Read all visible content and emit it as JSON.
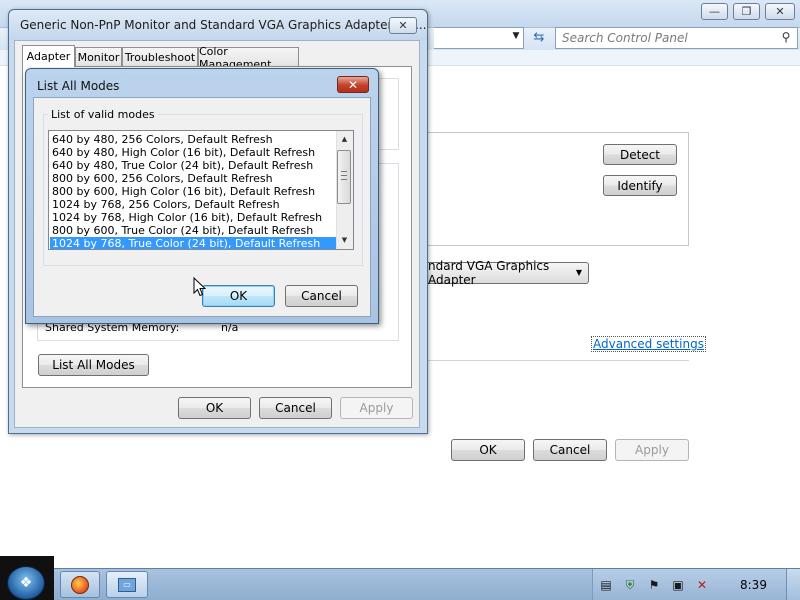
{
  "background_window": {
    "caption_buttons": [
      "—",
      "❐",
      "✕"
    ],
    "search_placeholder": "Search Control Panel",
    "detect_label": "Detect",
    "identify_label": "Identify",
    "adapter_select_value": "ndard VGA Graphics Adapter",
    "advanced_link": "Advanced settings",
    "ok_label": "OK",
    "cancel_label": "Cancel",
    "apply_label": "Apply"
  },
  "properties_dialog": {
    "title": "Generic Non-PnP Monitor and Standard VGA Graphics Adapter Pro...",
    "tabs": [
      "Adapter",
      "Monitor",
      "Troubleshoot",
      "Color Management"
    ],
    "active_tab": "Adapter",
    "shared_memory_label": "Shared System Memory:",
    "shared_memory_value": "n/a",
    "list_all_modes_label": "List All Modes",
    "ok_label": "OK",
    "cancel_label": "Cancel",
    "apply_label": "Apply"
  },
  "modes_dialog": {
    "title": "List All Modes",
    "group_label": "List of valid modes",
    "modes": [
      "640 by 480, 256 Colors, Default Refresh",
      "640 by 480, High Color (16 bit), Default Refresh",
      "640 by 480, True Color (24 bit), Default Refresh",
      "800 by 600, 256 Colors, Default Refresh",
      "800 by 600, High Color (16 bit), Default Refresh",
      "1024 by 768, 256 Colors, Default Refresh",
      "1024 by 768, High Color (16 bit), Default Refresh",
      "800 by 600, True Color (24 bit), Default Refresh",
      "1024 by 768, True Color (24 bit), Default Refresh"
    ],
    "selected_index": 8,
    "ok_label": "OK",
    "cancel_label": "Cancel"
  },
  "taskbar": {
    "clock": "8:39",
    "start_icon": "windows-logo-icon",
    "pinned": [
      "firefox-icon",
      "display-settings-icon"
    ],
    "tray_icons": [
      "document-icon",
      "security-shield-icon",
      "flag-icon",
      "network-icon",
      "volume-muted-icon"
    ]
  },
  "colors": {
    "selection": "#3399ff",
    "link": "#0066cc",
    "close_red": "#c7402b",
    "title_blue": "#c3d6ec"
  }
}
